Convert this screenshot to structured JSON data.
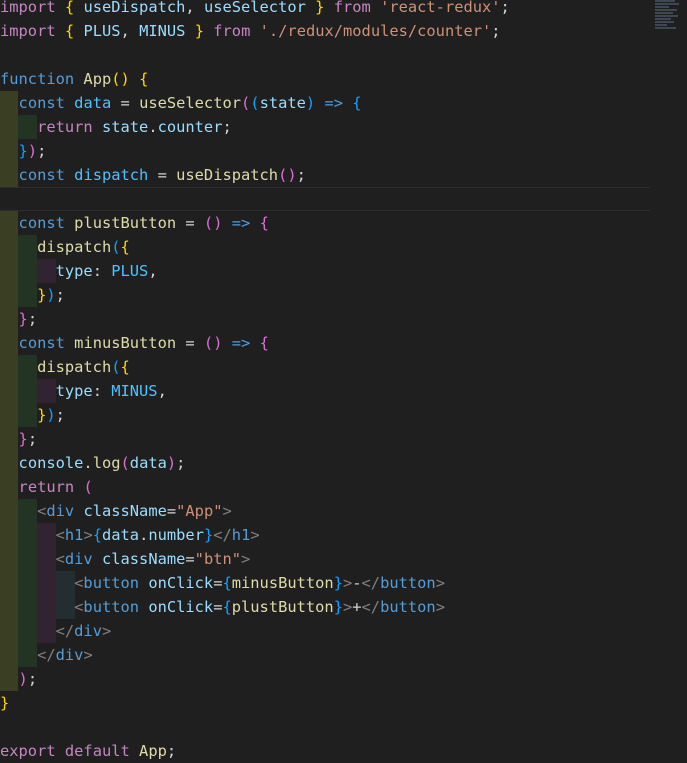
{
  "editor": {
    "language": "javascript-react",
    "lines": [
      {
        "indent": 0,
        "tokens": [
          [
            "tok-control",
            "import"
          ],
          [
            "tok-text",
            " "
          ],
          [
            "b1",
            "{"
          ],
          [
            "tok-text",
            " "
          ],
          [
            "tok-var",
            "useDispatch"
          ],
          [
            "tok-text",
            ", "
          ],
          [
            "tok-var",
            "useSelector"
          ],
          [
            "tok-text",
            " "
          ],
          [
            "b1",
            "}"
          ],
          [
            "tok-text",
            " "
          ],
          [
            "tok-control",
            "from"
          ],
          [
            "tok-text",
            " "
          ],
          [
            "tok-string",
            "'react-redux'"
          ],
          [
            "tok-text",
            ";"
          ]
        ]
      },
      {
        "indent": 0,
        "tokens": [
          [
            "tok-control",
            "import"
          ],
          [
            "tok-text",
            " "
          ],
          [
            "b1",
            "{"
          ],
          [
            "tok-text",
            " "
          ],
          [
            "tok-var",
            "PLUS"
          ],
          [
            "tok-text",
            ", "
          ],
          [
            "tok-var",
            "MINUS"
          ],
          [
            "tok-text",
            " "
          ],
          [
            "b1",
            "}"
          ],
          [
            "tok-text",
            " "
          ],
          [
            "tok-control",
            "from"
          ],
          [
            "tok-text",
            " "
          ],
          [
            "tok-string",
            "'./redux/modules/counter'"
          ],
          [
            "tok-text",
            ";"
          ]
        ]
      },
      {
        "indent": 0,
        "tokens": []
      },
      {
        "indent": 0,
        "tokens": [
          [
            "tok-keyword",
            "function"
          ],
          [
            "tok-text",
            " "
          ],
          [
            "tok-func",
            "App"
          ],
          [
            "b1",
            "()"
          ],
          [
            "tok-text",
            " "
          ],
          [
            "b1",
            "{"
          ]
        ]
      },
      {
        "indent": 1,
        "tokens": [
          [
            "tok-text",
            "  "
          ],
          [
            "tok-keyword",
            "const"
          ],
          [
            "tok-text",
            " "
          ],
          [
            "tok-const",
            "data"
          ],
          [
            "tok-text",
            " = "
          ],
          [
            "tok-func",
            "useSelector"
          ],
          [
            "b2",
            "("
          ],
          [
            "b3",
            "("
          ],
          [
            "tok-var",
            "state"
          ],
          [
            "b3",
            ")"
          ],
          [
            "tok-text",
            " "
          ],
          [
            "tok-keyword",
            "=>"
          ],
          [
            "tok-text",
            " "
          ],
          [
            "b3",
            "{"
          ]
        ]
      },
      {
        "indent": 2,
        "tokens": [
          [
            "tok-text",
            "    "
          ],
          [
            "tok-control",
            "return"
          ],
          [
            "tok-text",
            " "
          ],
          [
            "tok-var",
            "state"
          ],
          [
            "tok-text",
            "."
          ],
          [
            "tok-var",
            "counter"
          ],
          [
            "tok-text",
            ";"
          ]
        ]
      },
      {
        "indent": 1,
        "tokens": [
          [
            "tok-text",
            "  "
          ],
          [
            "b3",
            "}"
          ],
          [
            "b2",
            ")"
          ],
          [
            "tok-text",
            ";"
          ]
        ]
      },
      {
        "indent": 1,
        "tokens": [
          [
            "tok-text",
            "  "
          ],
          [
            "tok-keyword",
            "const"
          ],
          [
            "tok-text",
            " "
          ],
          [
            "tok-const",
            "dispatch"
          ],
          [
            "tok-text",
            " = "
          ],
          [
            "tok-func",
            "useDispatch"
          ],
          [
            "b2",
            "()"
          ],
          [
            "tok-text",
            ";"
          ]
        ]
      },
      {
        "indent": 0,
        "tokens": []
      },
      {
        "indent": 1,
        "tokens": [
          [
            "tok-text",
            "  "
          ],
          [
            "tok-keyword",
            "const"
          ],
          [
            "tok-text",
            " "
          ],
          [
            "tok-func",
            "plustButton"
          ],
          [
            "tok-text",
            " = "
          ],
          [
            "b2",
            "()"
          ],
          [
            "tok-text",
            " "
          ],
          [
            "tok-keyword",
            "=>"
          ],
          [
            "tok-text",
            " "
          ],
          [
            "b2",
            "{"
          ]
        ]
      },
      {
        "indent": 2,
        "tokens": [
          [
            "tok-text",
            "    "
          ],
          [
            "tok-func",
            "dispatch"
          ],
          [
            "b3",
            "("
          ],
          [
            "b1",
            "{"
          ]
        ]
      },
      {
        "indent": 3,
        "tokens": [
          [
            "tok-text",
            "      "
          ],
          [
            "tok-var",
            "type"
          ],
          [
            "tok-text",
            ": "
          ],
          [
            "tok-const",
            "PLUS"
          ],
          [
            "tok-text",
            ","
          ]
        ]
      },
      {
        "indent": 2,
        "tokens": [
          [
            "tok-text",
            "    "
          ],
          [
            "b1",
            "}"
          ],
          [
            "b3",
            ")"
          ],
          [
            "tok-text",
            ";"
          ]
        ]
      },
      {
        "indent": 1,
        "tokens": [
          [
            "tok-text",
            "  "
          ],
          [
            "b2",
            "}"
          ],
          [
            "tok-text",
            ";"
          ]
        ]
      },
      {
        "indent": 1,
        "tokens": [
          [
            "tok-text",
            "  "
          ],
          [
            "tok-keyword",
            "const"
          ],
          [
            "tok-text",
            " "
          ],
          [
            "tok-func",
            "minusButton"
          ],
          [
            "tok-text",
            " = "
          ],
          [
            "b2",
            "()"
          ],
          [
            "tok-text",
            " "
          ],
          [
            "tok-keyword",
            "=>"
          ],
          [
            "tok-text",
            " "
          ],
          [
            "b2",
            "{"
          ]
        ]
      },
      {
        "indent": 2,
        "tokens": [
          [
            "tok-text",
            "    "
          ],
          [
            "tok-func",
            "dispatch"
          ],
          [
            "b3",
            "("
          ],
          [
            "b1",
            "{"
          ]
        ]
      },
      {
        "indent": 3,
        "tokens": [
          [
            "tok-text",
            "      "
          ],
          [
            "tok-var",
            "type"
          ],
          [
            "tok-text",
            ": "
          ],
          [
            "tok-const",
            "MINUS"
          ],
          [
            "tok-text",
            ","
          ]
        ]
      },
      {
        "indent": 2,
        "tokens": [
          [
            "tok-text",
            "    "
          ],
          [
            "b1",
            "}"
          ],
          [
            "b3",
            ")"
          ],
          [
            "tok-text",
            ";"
          ]
        ]
      },
      {
        "indent": 1,
        "tokens": [
          [
            "tok-text",
            "  "
          ],
          [
            "b2",
            "}"
          ],
          [
            "tok-text",
            ";"
          ]
        ]
      },
      {
        "indent": 1,
        "tokens": [
          [
            "tok-text",
            "  "
          ],
          [
            "tok-var",
            "console"
          ],
          [
            "tok-text",
            "."
          ],
          [
            "tok-func",
            "log"
          ],
          [
            "b2",
            "("
          ],
          [
            "tok-var",
            "data"
          ],
          [
            "b2",
            ")"
          ],
          [
            "tok-text",
            ";"
          ]
        ]
      },
      {
        "indent": 1,
        "tokens": [
          [
            "tok-text",
            "  "
          ],
          [
            "tok-control",
            "return"
          ],
          [
            "tok-text",
            " "
          ],
          [
            "b2",
            "("
          ]
        ]
      },
      {
        "indent": 2,
        "tokens": [
          [
            "tok-text",
            "    "
          ],
          [
            "tok-tagpunc",
            "<"
          ],
          [
            "tok-tag",
            "div"
          ],
          [
            "tok-text",
            " "
          ],
          [
            "tok-attr",
            "className"
          ],
          [
            "tok-text",
            "="
          ],
          [
            "tok-string",
            "\"App\""
          ],
          [
            "tok-tagpunc",
            ">"
          ]
        ]
      },
      {
        "indent": 3,
        "tokens": [
          [
            "tok-text",
            "      "
          ],
          [
            "tok-tagpunc",
            "<"
          ],
          [
            "tok-tag",
            "h1"
          ],
          [
            "tok-tagpunc",
            ">"
          ],
          [
            "b3",
            "{"
          ],
          [
            "tok-var",
            "data"
          ],
          [
            "tok-text",
            "."
          ],
          [
            "tok-var",
            "number"
          ],
          [
            "b3",
            "}"
          ],
          [
            "tok-tagpunc",
            "</"
          ],
          [
            "tok-tag",
            "h1"
          ],
          [
            "tok-tagpunc",
            ">"
          ]
        ]
      },
      {
        "indent": 3,
        "tokens": [
          [
            "tok-text",
            "      "
          ],
          [
            "tok-tagpunc",
            "<"
          ],
          [
            "tok-tag",
            "div"
          ],
          [
            "tok-text",
            " "
          ],
          [
            "tok-attr",
            "className"
          ],
          [
            "tok-text",
            "="
          ],
          [
            "tok-string",
            "\"btn\""
          ],
          [
            "tok-tagpunc",
            ">"
          ]
        ]
      },
      {
        "indent": 4,
        "tokens": [
          [
            "tok-text",
            "        "
          ],
          [
            "tok-tagpunc",
            "<"
          ],
          [
            "tok-tag",
            "button"
          ],
          [
            "tok-text",
            " "
          ],
          [
            "tok-attr",
            "onClick"
          ],
          [
            "tok-text",
            "="
          ],
          [
            "b3",
            "{"
          ],
          [
            "tok-func",
            "minusButton"
          ],
          [
            "b3",
            "}"
          ],
          [
            "tok-tagpunc",
            ">"
          ],
          [
            "tok-text",
            "-"
          ],
          [
            "tok-tagpunc",
            "</"
          ],
          [
            "tok-tag",
            "button"
          ],
          [
            "tok-tagpunc",
            ">"
          ]
        ]
      },
      {
        "indent": 4,
        "tokens": [
          [
            "tok-text",
            "        "
          ],
          [
            "tok-tagpunc",
            "<"
          ],
          [
            "tok-tag",
            "button"
          ],
          [
            "tok-text",
            " "
          ],
          [
            "tok-attr",
            "onClick"
          ],
          [
            "tok-text",
            "="
          ],
          [
            "b3",
            "{"
          ],
          [
            "tok-func",
            "plustButton"
          ],
          [
            "b3",
            "}"
          ],
          [
            "tok-tagpunc",
            ">"
          ],
          [
            "tok-text",
            "+"
          ],
          [
            "tok-tagpunc",
            "</"
          ],
          [
            "tok-tag",
            "button"
          ],
          [
            "tok-tagpunc",
            ">"
          ]
        ]
      },
      {
        "indent": 3,
        "tokens": [
          [
            "tok-text",
            "      "
          ],
          [
            "tok-tagpunc",
            "</"
          ],
          [
            "tok-tag",
            "div"
          ],
          [
            "tok-tagpunc",
            ">"
          ]
        ]
      },
      {
        "indent": 2,
        "tokens": [
          [
            "tok-text",
            "    "
          ],
          [
            "tok-tagpunc",
            "</"
          ],
          [
            "tok-tag",
            "div"
          ],
          [
            "tok-tagpunc",
            ">"
          ]
        ]
      },
      {
        "indent": 1,
        "tokens": [
          [
            "tok-text",
            "  "
          ],
          [
            "b2",
            ")"
          ],
          [
            "tok-text",
            ";"
          ]
        ]
      },
      {
        "indent": 0,
        "tokens": [
          [
            "b1",
            "}"
          ]
        ]
      },
      {
        "indent": 0,
        "tokens": []
      },
      {
        "indent": 0,
        "tokens": [
          [
            "tok-control",
            "export"
          ],
          [
            "tok-text",
            " "
          ],
          [
            "tok-control",
            "default"
          ],
          [
            "tok-text",
            " "
          ],
          [
            "tok-func",
            "App"
          ],
          [
            "tok-text",
            ";"
          ]
        ]
      }
    ]
  }
}
